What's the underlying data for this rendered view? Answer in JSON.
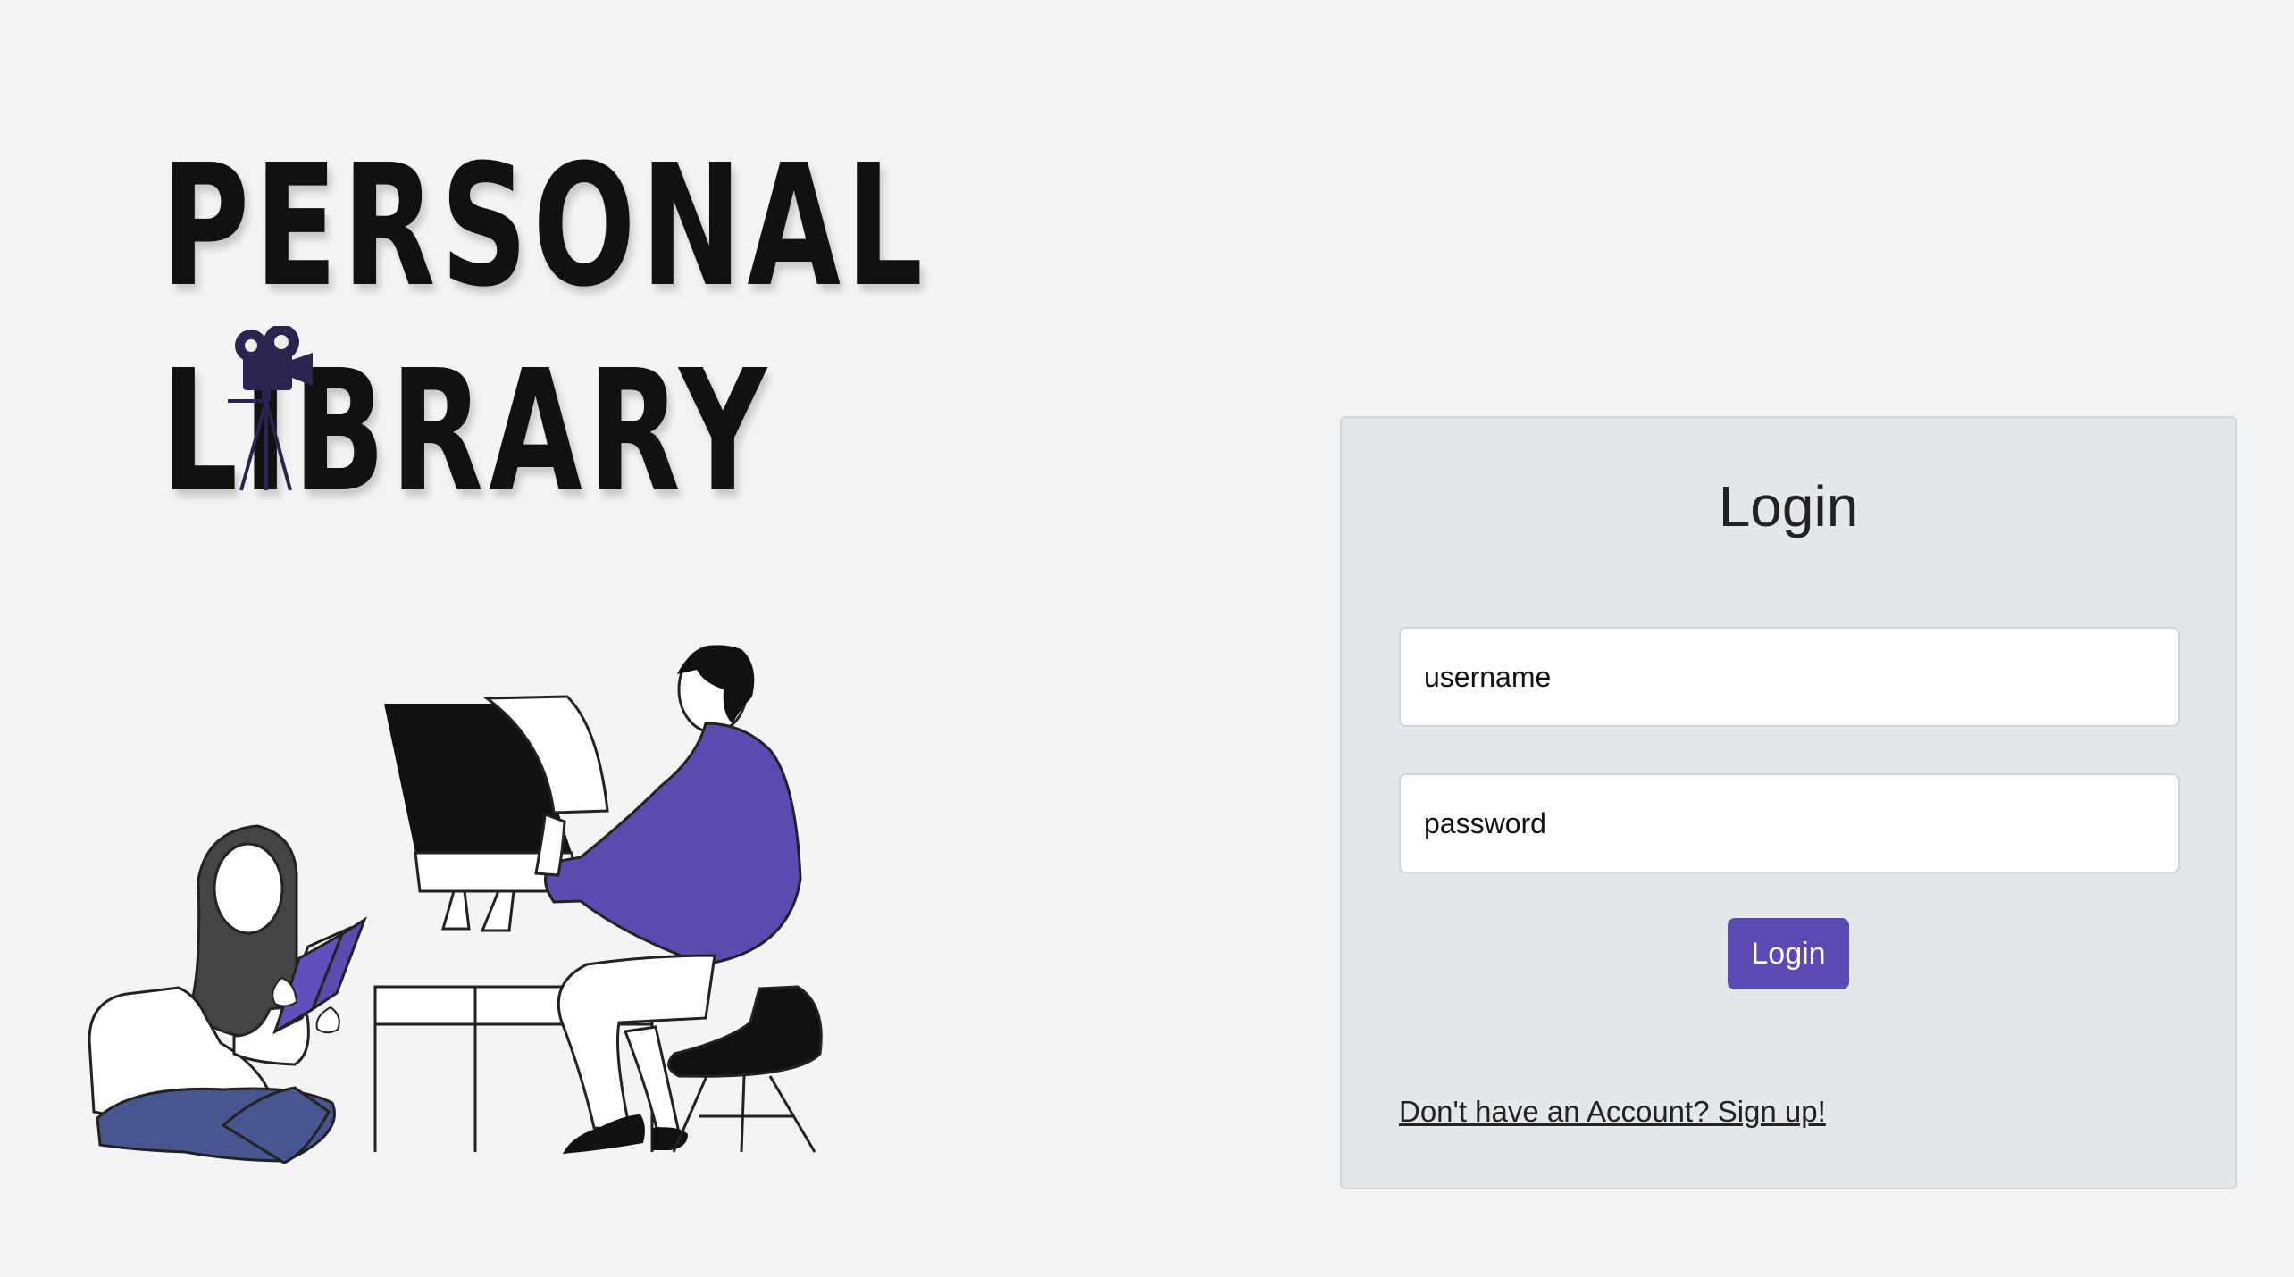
{
  "logo": {
    "line1": "PERSONAL",
    "line2": "LIBRARY",
    "camera_icon": "film-camera-icon"
  },
  "login": {
    "title": "Login",
    "username_placeholder": "username",
    "password_placeholder": "password",
    "button_label": "Login",
    "signup_link": "Don't have an Account? Sign up!"
  },
  "colors": {
    "background": "#f4f4f4",
    "panel": "#e5e8eb",
    "accent": "#5c49b2",
    "jeans": "#47568f"
  }
}
